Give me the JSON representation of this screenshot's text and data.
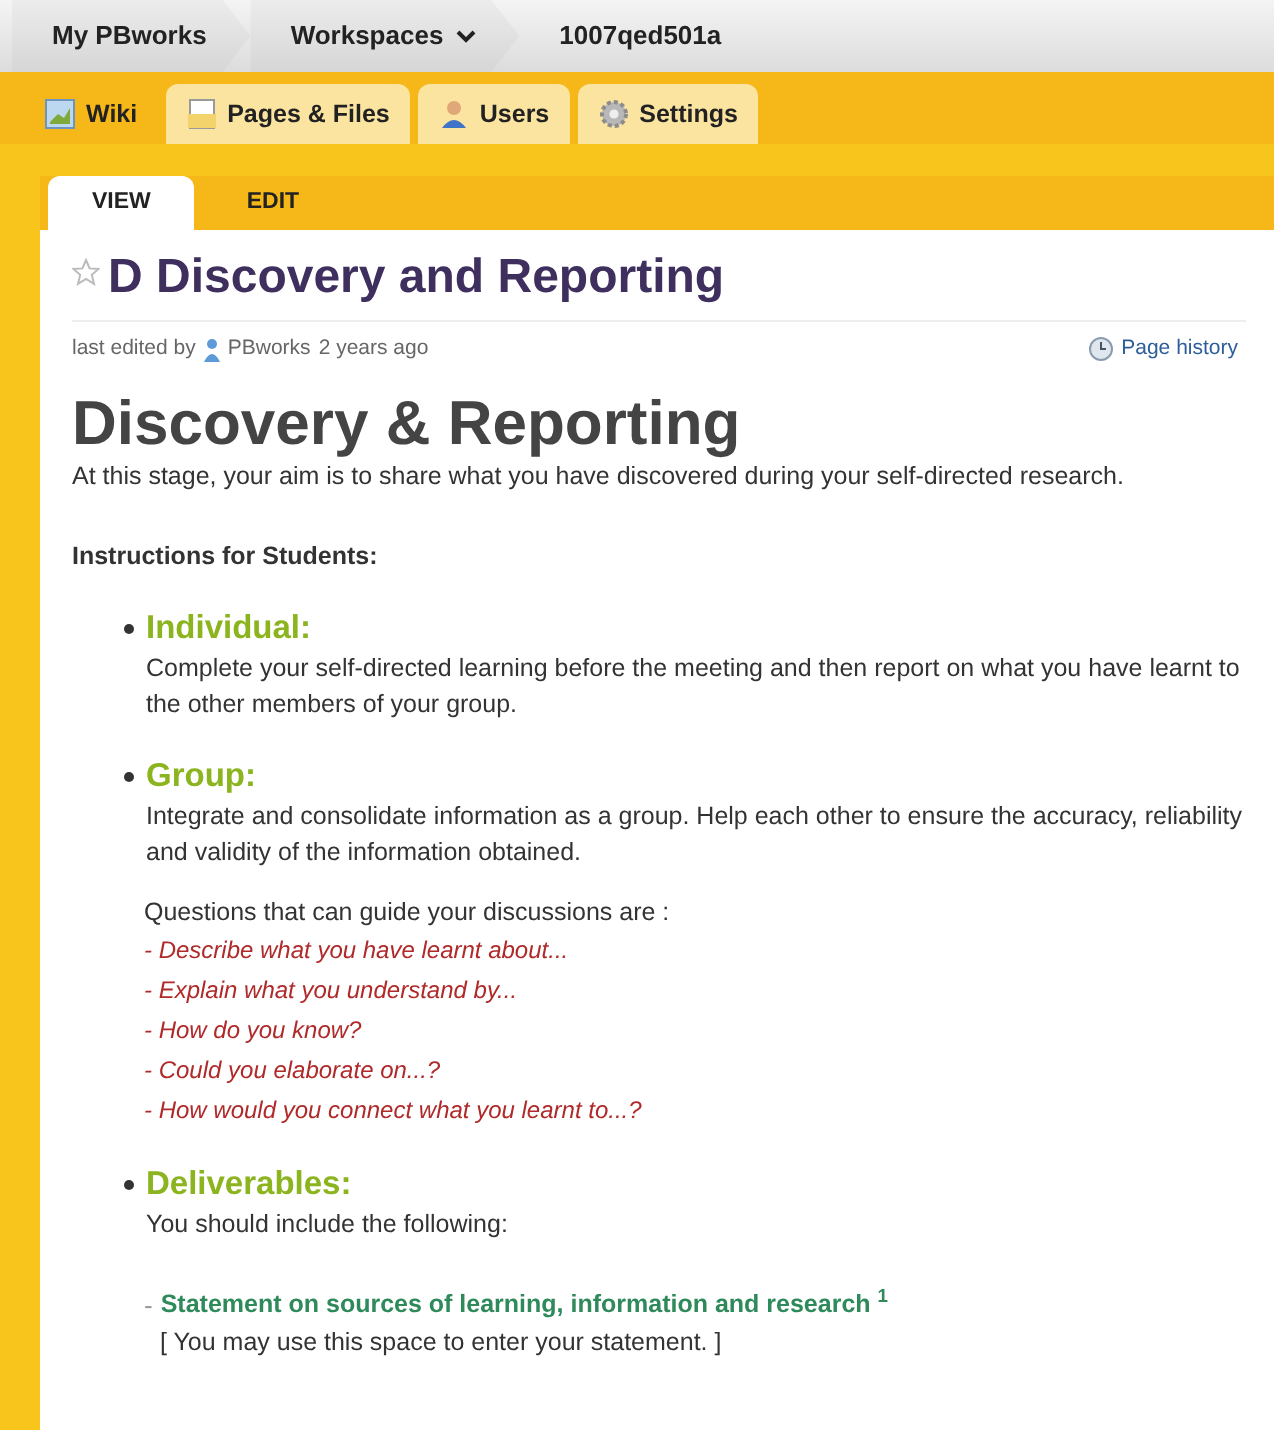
{
  "breadcrumb": [
    {
      "label": "My PBworks",
      "dropdown": false
    },
    {
      "label": "Workspaces",
      "dropdown": true
    },
    {
      "label": "1007qed501a",
      "dropdown": false
    }
  ],
  "tabs": [
    {
      "label": "Wiki",
      "selected": true
    },
    {
      "label": "Pages & Files",
      "selected": false
    },
    {
      "label": "Users",
      "selected": false
    },
    {
      "label": "Settings",
      "selected": false
    }
  ],
  "view_tabs": [
    {
      "label": "VIEW",
      "selected": true
    },
    {
      "label": "EDIT",
      "selected": false
    }
  ],
  "page": {
    "title": "D Discovery and Reporting",
    "starred": false,
    "meta": {
      "prefix": "last edited by",
      "author": "PBworks",
      "time": "2 years ago"
    },
    "history_link": "Page history",
    "heading": "Discovery & Reporting",
    "intro": "At this stage, your aim is to share what you have discovered during your self-directed research.",
    "instructions_label": "Instructions for Students:",
    "sections": [
      {
        "heading": "Individual:",
        "text": "Complete your self-directed learning before the meeting and then report on what you have learnt to the other members of your group."
      },
      {
        "heading": "Group:",
        "text": "Integrate and consolidate information as a group.  Help each other to ensure the accuracy, reliability and validity of the information obtained.",
        "prompt": "Questions that can guide your discussions are :",
        "questions": [
          "- Describe what you have learnt about...",
          "- Explain what you understand by...",
          "- How do you know?",
          "- Could you elaborate on...?",
          "- How would you connect what you learnt to...?"
        ]
      },
      {
        "heading": "Deliverables:",
        "text": "You should include the following:",
        "deliverable": {
          "dash": "-",
          "title": "Statement on sources of learning, information and research $^{1}$",
          "note": "[ You may use this space to enter your statement. ]"
        }
      }
    ]
  }
}
